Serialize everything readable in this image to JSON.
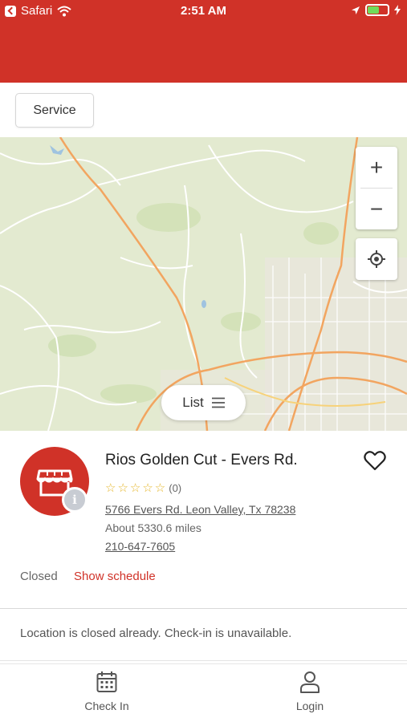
{
  "status_bar": {
    "back_app": "Safari",
    "time": "2:51 AM",
    "battery_level": 0.6
  },
  "filter": {
    "service_label": "Service"
  },
  "map": {
    "zoom_in": "+",
    "zoom_out": "−",
    "locate_icon": "crosshair-icon",
    "list_label": "List",
    "list_icon": "hamburger-icon"
  },
  "location": {
    "name": "Rios Golden Cut - Evers Rd.",
    "stars": "☆☆☆☆☆",
    "review_count": "(0)",
    "rating": 0,
    "address": "5766 Evers Rd. Leon Valley, Tx 78238",
    "distance": "About 5330.6 miles",
    "phone": "210-647-7605",
    "status": "Closed",
    "schedule_link": "Show schedule",
    "info_badge": "i"
  },
  "notice": {
    "text": "Location is closed already. Check-in is unavailable."
  },
  "tabbar": {
    "checkin_label": "Check In",
    "login_label": "Login"
  },
  "colors": {
    "brand": "#d03228",
    "star": "#e5b62a",
    "map_bg": "#e3ead0"
  }
}
